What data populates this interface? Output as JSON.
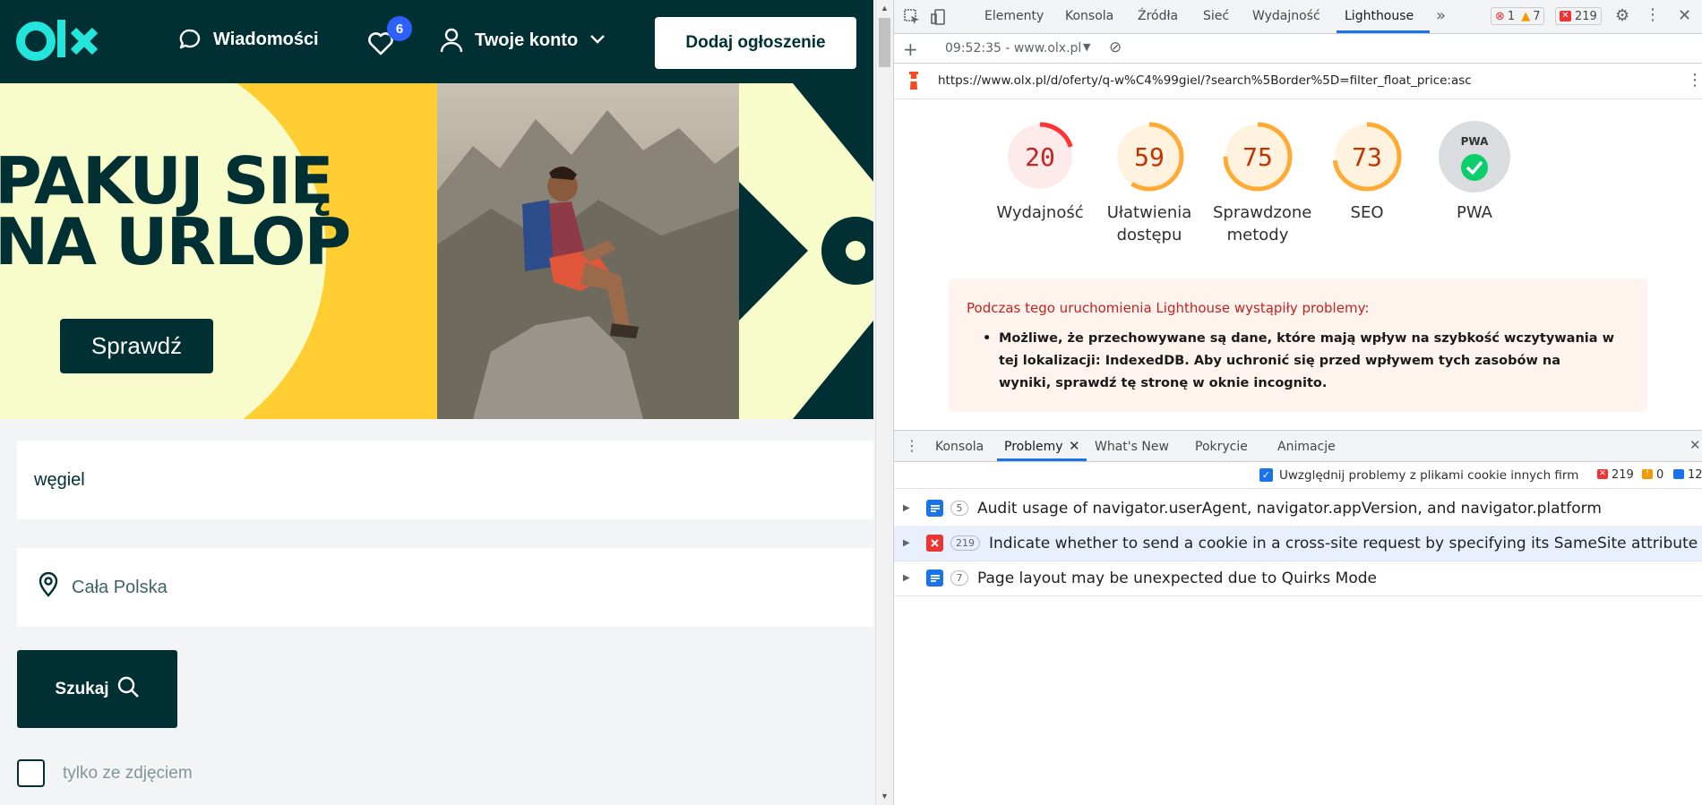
{
  "olx": {
    "header": {
      "messages_label": "Wiadomości",
      "favorites_count": "6",
      "account_label": "Twoje konto",
      "add_listing_label": "Dodaj ogłoszenie"
    },
    "banner": {
      "line1": "PAKUJ SIĘ",
      "line2": "NA URLOP",
      "button_label": "Sprawdź"
    },
    "search": {
      "query_value": "węgiel",
      "location_value": "Cała Polska",
      "button_label": "Szukaj",
      "photo_only_label": "tylko ze zdjęciem"
    },
    "colors": {
      "brand_dark": "#002f34",
      "accent": "#23e5db",
      "yellow": "#ffce32"
    }
  },
  "devtools": {
    "tabs": [
      "Elementy",
      "Konsola",
      "Źródła",
      "Sieć",
      "Wydajność",
      "Lighthouse"
    ],
    "active_tab": "Lighthouse",
    "counts": {
      "errors": "1",
      "warnings": "7",
      "issues": "219"
    },
    "report_time": "09:52:35 - www.olx.pl",
    "url": "https://www.olx.pl/d/oferty/q-w%C4%99giel/?search%5Border%5D=filter_float_price:asc",
    "scores": [
      {
        "label": "Wydajność",
        "value": 20,
        "color": "#ff3333",
        "bg": "#fdeaea",
        "text": "#c7221f"
      },
      {
        "label": "Ułatwienia dostępu",
        "value": 59,
        "color": "#ffaa33",
        "bg": "#fff3e0",
        "text": "#c33300"
      },
      {
        "label": "Sprawdzone metody",
        "value": 75,
        "color": "#ffaa33",
        "bg": "#fff3e0",
        "text": "#c33300"
      },
      {
        "label": "SEO",
        "value": 73,
        "color": "#ffaa33",
        "bg": "#fff3e0",
        "text": "#c33300"
      }
    ],
    "pwa": {
      "label": "PWA",
      "badge": "PWA"
    },
    "warning": {
      "title": "Podczas tego uruchomienia Lighthouse wystąpiły problemy:",
      "item": "Możliwe, że przechowywane są dane, które mają wpływ na szybkość wczytywania w tej lokalizacji: IndexedDB. Aby uchronić się przed wpływem tych zasobów na wyniki, sprawdź tę stronę w oknie incognito."
    },
    "drawer": {
      "tabs": [
        "Konsola",
        "Problemy",
        "What's New",
        "Pokrycie",
        "Animacje"
      ],
      "active_tab": "Problemy",
      "filter_label": "Uwzględnij problemy z plikami cookie innych firm",
      "counts": {
        "errors": "219",
        "warnings": "0",
        "info": "12"
      }
    },
    "issues": [
      {
        "type": "info",
        "count": "5",
        "text": "Audit usage of navigator.userAgent, navigator.appVersion, and navigator.platform"
      },
      {
        "type": "error",
        "count": "219",
        "text": "Indicate whether to send a cookie in a cross-site request by specifying its SameSite attribute"
      },
      {
        "type": "info",
        "count": "7",
        "text": "Page layout may be unexpected due to Quirks Mode"
      }
    ]
  }
}
